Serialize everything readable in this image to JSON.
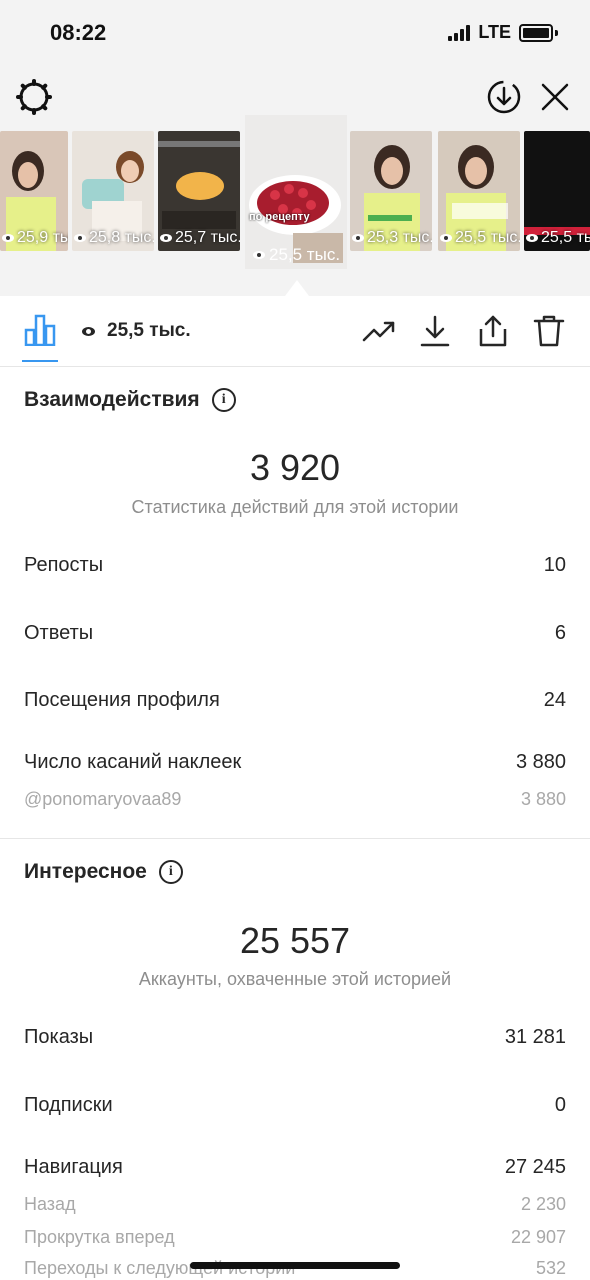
{
  "status_bar": {
    "time": "08:22",
    "network": "LTE"
  },
  "stories_strip": [
    {
      "views": "25,9 тыс.",
      "bg": "#d9c6b8",
      "accent": "#e6f08a"
    },
    {
      "views": "25,8 тыс.",
      "bg": "#e9e3dc",
      "accent": "#9fd3d0"
    },
    {
      "views": "25,7 тыс.",
      "bg": "#3a3631",
      "accent": "#f2b44a"
    },
    {
      "views": "25,3 тыс.",
      "bg": "#d9cfc6",
      "accent": "#e6f08a"
    },
    {
      "views": "25,5 тыс.",
      "bg": "#d6cabd",
      "accent": "#e6f08a"
    },
    {
      "views": "25,5 тыс.",
      "bg": "#111111",
      "accent": "#d0213a"
    }
  ],
  "selected_story": {
    "views": "25,5 тыс.",
    "label": "по рецепту"
  },
  "toolbar": {
    "views": "25,5 тыс."
  },
  "interactions": {
    "title": "Взаимодействия",
    "total": "3 920",
    "caption": "Статистика действий для этой истории",
    "rows": [
      {
        "label": "Репосты",
        "value": "10"
      },
      {
        "label": "Ответы",
        "value": "6"
      },
      {
        "label": "Посещения профиля",
        "value": "24"
      },
      {
        "label": "Число касаний наклеек",
        "value": "3 880"
      }
    ],
    "sticker_account": {
      "label": "@ponomaryovaa89",
      "value": "3 880"
    }
  },
  "discovery": {
    "title": "Интересное",
    "total": "25 557",
    "caption": "Аккаунты, охваченные этой историей",
    "rows": [
      {
        "label": "Показы",
        "value": "31 281"
      },
      {
        "label": "Подписки",
        "value": "0"
      },
      {
        "label": "Навигация",
        "value": "27 245"
      }
    ],
    "navigation_sub": [
      {
        "label": "Назад",
        "value": "2 230"
      },
      {
        "label": "Прокрутка вперед",
        "value": "22 907"
      },
      {
        "label": "Переходы к следующей истории",
        "value": "532"
      }
    ]
  },
  "colors": {
    "accent": "#3897f0",
    "muted": "#8e8e8e",
    "text": "#262626"
  }
}
